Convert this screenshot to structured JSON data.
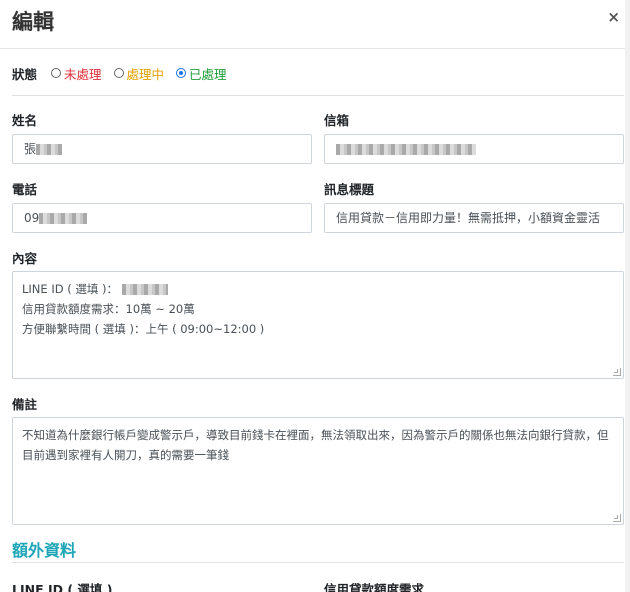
{
  "modal": {
    "title": "編輯",
    "close_symbol": "×"
  },
  "status": {
    "label": "狀態",
    "options": [
      {
        "label": "未處理",
        "color": "#e0303a",
        "checked": false
      },
      {
        "label": "處理中",
        "color": "#e6a100",
        "checked": false
      },
      {
        "label": "已處理",
        "color": "#1e9e3a",
        "checked": true
      }
    ]
  },
  "fields": {
    "name_label": "姓名",
    "name_value": "張",
    "email_label": "信箱",
    "phone_label": "電話",
    "phone_value": "09",
    "subject_label": "訊息標題",
    "subject_value": "信用貸款－信用即力量！無需抵押，小額資金靈活",
    "content_label": "內容",
    "content_lines": [
      "LINE ID ( 選填 )：",
      "信用貸款額度需求：10萬 ~ 20萬",
      "方便聯繫時間 ( 選填 )：上午 ( 09:00~12:00 )"
    ],
    "note_label": "備註",
    "note_value": "不知道為什麼銀行帳戶變成警示戶，導致目前錢卡在裡面，無法領取出來，因為警示戶的關係也無法向銀行貸款，但目前遇到家裡有人開刀，真的需要一筆錢"
  },
  "extra": {
    "section_title": "額外資料",
    "line_id_label": "LINE ID ( 選填 )",
    "loan_label": "信用貸款額度需求"
  },
  "colors": {
    "accent": "#1ea5b7",
    "radio_checked": "#1a73e8"
  }
}
